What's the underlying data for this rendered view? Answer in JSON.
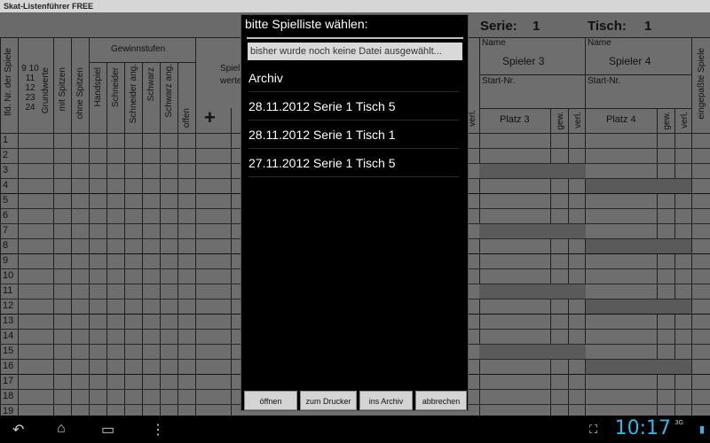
{
  "app": {
    "title": "Skat-Listenführer FREE"
  },
  "sheet": {
    "serie_label": "Serie:",
    "serie_value": "1",
    "tisch_label": "Tisch:",
    "tisch_value": "1",
    "col_headers": {
      "lfd": "lfd. Nr. der Spiele",
      "grundwerte_nums": "9 10 11 12 23 24",
      "grundwerte": "Grundwerte",
      "mit_spitzen": "mit Spitzen",
      "ohne_spitzen": "ohne Spitzen",
      "gewinnstufen": "Gewinnstufen",
      "handspiel": "Handspiel",
      "schneider": "Schneider",
      "schneider_ang": "Schneider ang.",
      "schwarz": "Schwarz",
      "schwarz_ang": "Schwarz ang.",
      "offen": "offen",
      "plus": "+",
      "spiel_partial": "Spiel",
      "werte_partial": "werte",
      "name3": "Name",
      "spieler3": "Spieler 3",
      "startnr3": "Start-Nr.",
      "platz3": "Platz 3",
      "gew3": "gew.",
      "verl3": "verl.",
      "name4": "Name",
      "spieler4": "Spieler 4",
      "startnr4": "Start-Nr.",
      "platz4": "Platz 4",
      "gew4": "gew.",
      "verl4": "verl.",
      "verl_partial": "verl.",
      "eingepasste": "eingepaßte Spiele"
    },
    "rows": [
      "1",
      "2",
      "3",
      "4",
      "5",
      "6",
      "7",
      "8",
      "9",
      "10",
      "11",
      "12",
      "13",
      "14",
      "15",
      "16",
      "17",
      "18",
      "19"
    ]
  },
  "dialog": {
    "title": "bitte Spielliste wählen:",
    "file_status": "bisher wurde noch keine Datei ausgewählt...",
    "items": [
      {
        "label": "Archiv"
      },
      {
        "label": "28.11.2012    Serie 1    Tisch 5"
      },
      {
        "label": "28.11.2012    Serie 1    Tisch 1"
      },
      {
        "label": "27.11.2012    Serie 1    Tisch 5"
      }
    ],
    "buttons": {
      "open": "öffnen",
      "print": "zum Drucker",
      "archive": "ins Archiv",
      "cancel": "abbrechen"
    }
  },
  "statusbar": {
    "clock": "10:17",
    "network": "3G"
  }
}
